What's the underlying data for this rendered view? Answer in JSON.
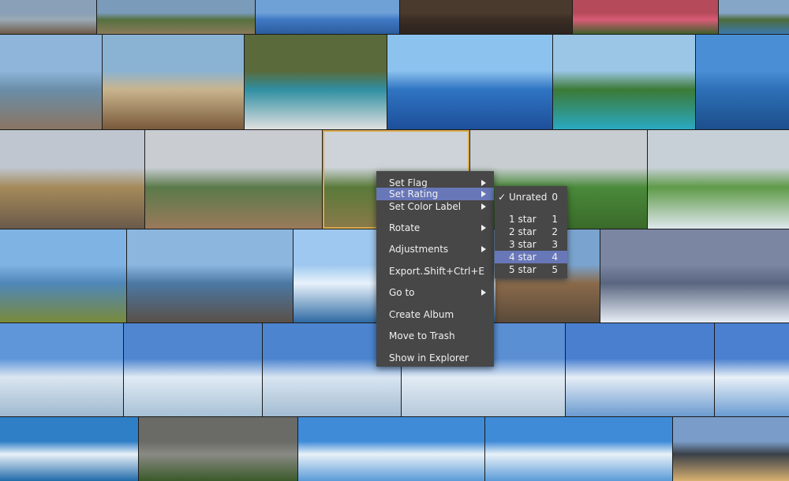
{
  "photo_grid": {
    "selected_thumbnail": "Mountain valley with river",
    "thumbnails": [
      {
        "subject": "Resort pool terrace",
        "palette": [
          "#8aa0b8",
          "#9aa9b4",
          "#6d5a48"
        ]
      },
      {
        "subject": "Palm garden",
        "palette": [
          "#7a9bb9",
          "#56703f",
          "#8a7a5a"
        ]
      },
      {
        "subject": "Infinity pool",
        "palette": [
          "#6fa0d6",
          "#3f79c4",
          "#2c5c9b"
        ]
      },
      {
        "subject": "Wooden deck",
        "palette": [
          "#4a3a2e",
          "#3a2d24",
          "#2d241e"
        ]
      },
      {
        "subject": "Pink flowers",
        "palette": [
          "#b54a5a",
          "#d85b76",
          "#3f5f2a"
        ]
      },
      {
        "subject": "Pool with palms",
        "palette": [
          "#86a6c8",
          "#4d6b3c",
          "#3a79b0"
        ]
      },
      {
        "subject": "Pool deck",
        "palette": [
          "#8fb5da",
          "#6a8ea8",
          "#8a7462"
        ]
      },
      {
        "subject": "Restaurant hall",
        "palette": [
          "#8ab3d3",
          "#c9b48c",
          "#7a5a3c"
        ]
      },
      {
        "subject": "Beach towels",
        "palette": [
          "#5a6a3a",
          "#2f8fa2",
          "#e0e0e0"
        ]
      },
      {
        "subject": "Sea swimmer",
        "palette": [
          "#8cc2ee",
          "#2f74c2",
          "#1d4f9a"
        ]
      },
      {
        "subject": "Fountain garden",
        "palette": [
          "#9cc6e6",
          "#3b7a36",
          "#2aa9c2"
        ]
      },
      {
        "subject": "Harbor",
        "palette": [
          "#4a8fd6",
          "#2d6fb6",
          "#1c4f8c"
        ]
      },
      {
        "subject": "Tundra plain",
        "palette": [
          "#bfc6cf",
          "#a58a5a",
          "#6a5a4a"
        ]
      },
      {
        "subject": "Canyon river",
        "palette": [
          "#c9cdd2",
          "#5a7a4a",
          "#9a7a5a"
        ]
      },
      {
        "subject": "Mountain valley with river",
        "palette": [
          "#cdd3d8",
          "#5a7a3a",
          "#8a7a4a"
        ]
      },
      {
        "subject": "Green valley waterfall",
        "palette": [
          "#c8cdd1",
          "#4a8a3a",
          "#3a6a2a"
        ]
      },
      {
        "subject": "Waterfall",
        "palette": [
          "#c7d0d6",
          "#5f9a48",
          "#dfe8ee"
        ]
      },
      {
        "subject": "Coast flowers",
        "palette": [
          "#7fb3e4",
          "#4f87b8",
          "#7a8a3a"
        ]
      },
      {
        "subject": "Rocky fjord",
        "palette": [
          "#8cb6de",
          "#4b78a3",
          "#5a5048"
        ]
      },
      {
        "subject": "Iceberg close-up",
        "palette": [
          "#9ec8ef",
          "#e8f2fb",
          "#2f6aa3"
        ]
      },
      {
        "subject": "Iceberg behind menu",
        "palette": [
          "#8ab3dc",
          "#dfeaf4",
          "#2d5f8f"
        ]
      },
      {
        "subject": "Rocky shore",
        "palette": [
          "#7aa4cf",
          "#8a6a4a",
          "#5a4a3a"
        ]
      },
      {
        "subject": "Floating iceberg",
        "palette": [
          "#7a86a2",
          "#5a6680",
          "#e8eef6"
        ]
      },
      {
        "subject": "Glacier front",
        "palette": [
          "#5f96da",
          "#dbe6f1",
          "#9fb9cf"
        ]
      },
      {
        "subject": "Glacier wall",
        "palette": [
          "#4f86cf",
          "#e1ebf4",
          "#a7c1d6"
        ]
      },
      {
        "subject": "Glacier wall 2",
        "palette": [
          "#4c84cf",
          "#d8e5f1",
          "#a3bcd2"
        ]
      },
      {
        "subject": "Glacier ice",
        "palette": [
          "#5b8fd4",
          "#e3ecf5",
          "#b5c8da"
        ]
      },
      {
        "subject": "Glacier reflection",
        "palette": [
          "#4a7fcf",
          "#e6eef6",
          "#6b9bd0"
        ]
      },
      {
        "subject": "Glacier reflection 2",
        "palette": [
          "#4a80cf",
          "#e8f0f7",
          "#6a9cd2"
        ]
      },
      {
        "subject": "Ice floes",
        "palette": [
          "#2f7fc6",
          "#e9f1f8",
          "#1f6aa8"
        ]
      },
      {
        "subject": "Wooden boardwalk",
        "palette": [
          "#6a6a66",
          "#8a8a84",
          "#3a5a2a"
        ]
      },
      {
        "subject": "Iceberg at sea",
        "palette": [
          "#3f8bd8",
          "#e8f1f8",
          "#5a9ad8"
        ]
      },
      {
        "subject": "Iceberg at sea 2",
        "palette": [
          "#3f8bd8",
          "#e8f1f8",
          "#5a9ad8"
        ]
      },
      {
        "subject": "Mountain peak",
        "palette": [
          "#7a9cc8",
          "#3a4048",
          "#d8b070"
        ]
      }
    ]
  },
  "context_menu": {
    "items": [
      {
        "label": "Set Flag",
        "submenu": true
      },
      {
        "label": "Set Rating",
        "submenu": true,
        "highlighted": true
      },
      {
        "label": "Set Color Label",
        "submenu": true
      },
      {
        "label": "Rotate",
        "submenu": true
      },
      {
        "label": "Adjustments",
        "submenu": true
      },
      {
        "label": "Export...",
        "shortcut": "Shift+Ctrl+E"
      },
      {
        "label": "Go to",
        "submenu": true
      },
      {
        "label": "Create Album"
      },
      {
        "label": "Move to Trash"
      },
      {
        "label": "Show in Explorer"
      }
    ]
  },
  "rating_submenu": {
    "check_mark": "✓",
    "items": [
      {
        "label": "Unrated",
        "key": "0",
        "checked": true
      },
      {
        "label": "1 star",
        "key": "1"
      },
      {
        "label": "2 star",
        "key": "2"
      },
      {
        "label": "3 star",
        "key": "3"
      },
      {
        "label": "4 star",
        "key": "4",
        "highlighted": true
      },
      {
        "label": "5 star",
        "key": "5"
      }
    ]
  },
  "colors": {
    "menu_bg": "#474747",
    "highlight": "#6877b8",
    "selection_border": "#d8a94a",
    "text": "#f0f0f0"
  }
}
